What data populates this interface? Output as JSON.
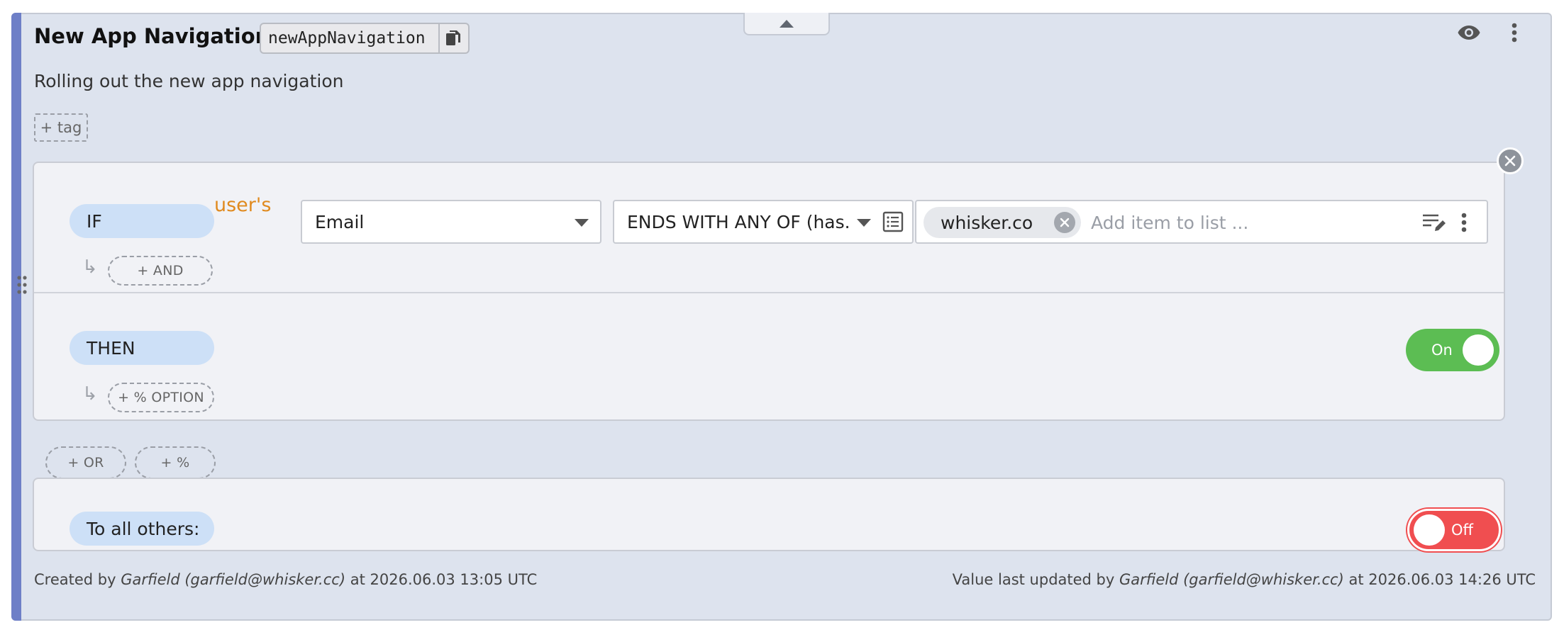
{
  "flag": {
    "title": "New App Navigation",
    "key": "newAppNavigation",
    "description": "Rolling out the new app navigation",
    "add_tag_label": "+ tag"
  },
  "rule": {
    "if_label": "IF",
    "subject_label": "user's",
    "attribute": "Email",
    "comparator": "ENDS WITH ANY OF (has...",
    "list_values": [
      "whisker.co"
    ],
    "list_placeholder": "Add item to list ...",
    "add_and_label": "+ AND",
    "then_label": "THEN",
    "add_option_label": "+ % OPTION",
    "then_toggle_label": "On",
    "then_toggle_state": true
  },
  "actions": {
    "add_or_label": "+ OR",
    "add_percent_label": "+ %"
  },
  "fallback": {
    "label": "To all others:",
    "toggle_label": "Off",
    "toggle_state": false
  },
  "footer": {
    "created_prefix": "Created by",
    "created_by": "Garfield (garfield@whisker.cc)",
    "created_at": "at 2026.06.03 13:05 UTC",
    "updated_prefix": "Value last updated by",
    "updated_by": "Garfield (garfield@whisker.cc)",
    "updated_at": "at 2026.06.03 14:26 UTC"
  },
  "colors": {
    "accent_bar": "#6e7fc7",
    "card_bg": "#dde3ee",
    "pill_bg": "#cde0f7",
    "subject_orange": "#e08a1e",
    "toggle_on": "#5cbd53",
    "toggle_off": "#f04e50"
  },
  "icons": {
    "copy": "copy-icon",
    "visibility": "eye-icon",
    "more": "more-vertical-icon",
    "list_view": "list-icon",
    "edit_list": "edit-list-icon",
    "remove_chip": "close-circle-icon",
    "close_rule": "close-icon",
    "drag": "drag-handle-icon",
    "collapse": "chevron-up-icon"
  }
}
